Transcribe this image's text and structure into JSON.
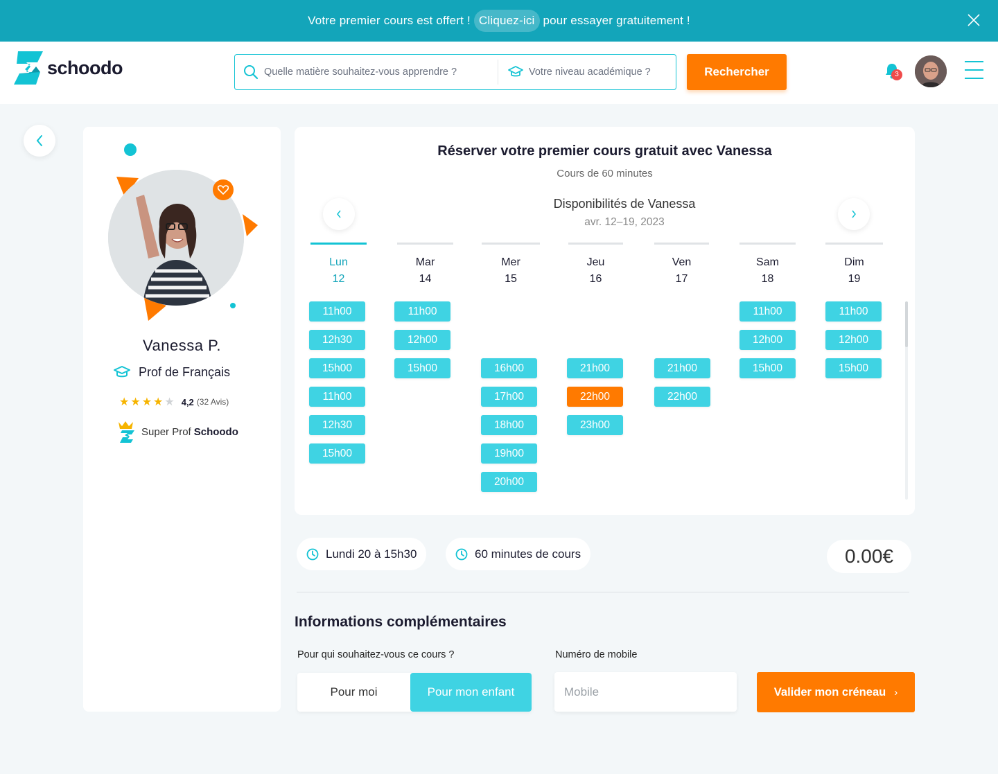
{
  "promo": {
    "text_before": "Votre premier cours est offert !",
    "cta": "Cliquez-ici",
    "text_after": "pour essayer gratuitement !"
  },
  "header": {
    "logo_text": "schoodo",
    "search_subject_placeholder": "Quelle matière souhaitez-vous apprendre ?",
    "search_level_placeholder": "Votre niveau académique ?",
    "search_button": "Rechercher",
    "notification_count": "3"
  },
  "profile": {
    "name": "Vanessa P.",
    "subject": "Prof de Français",
    "rating": "4,2",
    "reviews": "(32 Avis)",
    "stars_filled": 4,
    "stars_total": 5,
    "badge_prefix": "Super Prof",
    "badge_brand": "Schoodo"
  },
  "booking": {
    "title": "Réserver votre premier cours gratuit avec Vanessa",
    "subtitle": "Cours de 60 minutes",
    "availability_title": "Disponibilités de Vanessa",
    "date_range": "avr. 12–19, 2023",
    "days": [
      {
        "name": "Lun",
        "date": "12",
        "active": true,
        "slots": [
          "11h00",
          "12h30",
          "15h00",
          "11h00",
          "12h30",
          "15h00"
        ]
      },
      {
        "name": "Mar",
        "date": "14",
        "slots": [
          "11h00",
          "12h00",
          "15h00"
        ]
      },
      {
        "name": "Mer",
        "date": "15",
        "slots": [
          "16h00",
          "17h00",
          "18h00",
          "19h00",
          "20h00"
        ]
      },
      {
        "name": "Jeu",
        "date": "16",
        "slots": [
          "21h00",
          "22h00",
          "23h00"
        ],
        "selected": "22h00"
      },
      {
        "name": "Ven",
        "date": "17",
        "slots": [
          "21h00",
          "22h00"
        ]
      },
      {
        "name": "Sam",
        "date": "18",
        "slots": [
          "11h00",
          "12h00",
          "15h00"
        ]
      },
      {
        "name": "Dim",
        "date": "19",
        "slots": [
          "11h00",
          "12h00",
          "15h00"
        ]
      }
    ]
  },
  "summary": {
    "datetime": "Lundi 20 à 15h30",
    "duration": "60 minutes de cours",
    "price": "0.00€"
  },
  "form": {
    "section_title": "Informations complémentaires",
    "question_for_who": "Pour qui souhaitez-vous ce cours ?",
    "option_me": "Pour moi",
    "option_child": "Pour mon enfant",
    "selected_option": "Pour mon enfant",
    "mobile_label": "Numéro de mobile",
    "mobile_placeholder": "Mobile",
    "submit": "Valider mon créneau"
  },
  "colors": {
    "teal": "#13a5ba",
    "cyan": "#3fd3e3",
    "orange": "#ff7a00"
  }
}
